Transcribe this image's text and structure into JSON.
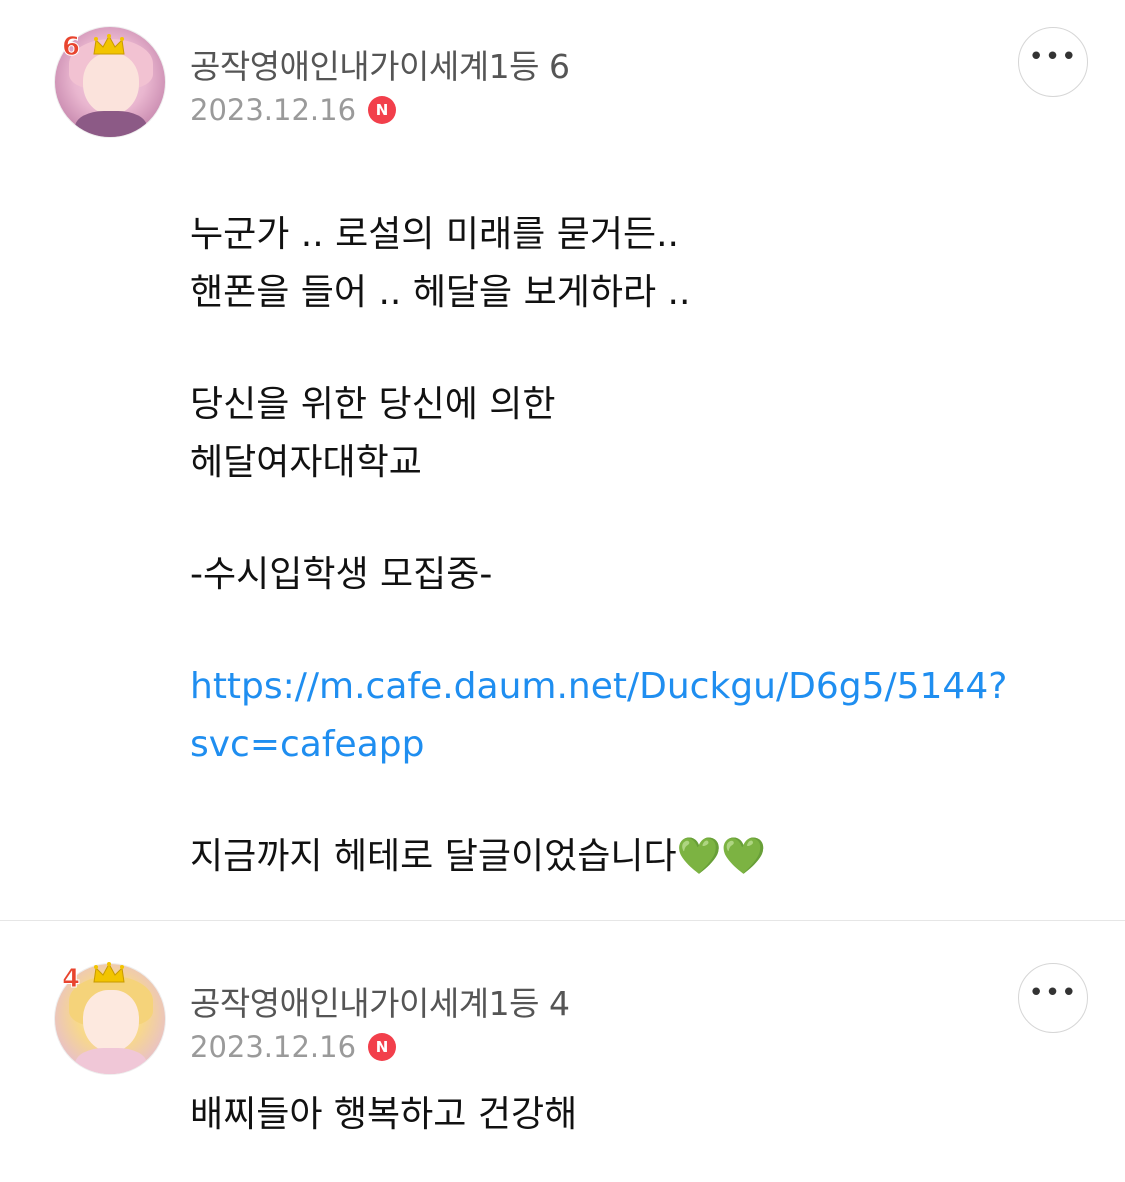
{
  "comments": [
    {
      "nickname": "공작영애인내가이세계1등 6",
      "rank_badge": "6",
      "date": "2023.12.16",
      "new_badge": "N",
      "more_icon": "•••",
      "body": {
        "line1": "누군가 .. 로설의 미래를 묻거든..",
        "line2": "핸폰을 들어 .. 헤달을 보게하라 ..",
        "line3": "당신을 위한 당신에 의한",
        "line4": "헤달여자대학교",
        "line5": "-수시입학생 모집중-",
        "link_line1": "https://m.cafe.daum.net/Duckgu/D6g5/5144?",
        "link_line2": "svc=cafeapp",
        "line6": "지금까지 헤테로 달글이었습니다",
        "hearts": "💚💚"
      }
    },
    {
      "nickname": "공작영애인내가이세계1등 4",
      "rank_badge": "4",
      "date": "2023.12.16",
      "new_badge": "N",
      "more_icon": "•••",
      "body": {
        "line1": "배찌들아 행복하고 건강해"
      }
    }
  ],
  "colors": {
    "link": "#1f8ef0",
    "new_badge": "#f23f4b",
    "date": "#9a9a9a",
    "nickname": "#555555",
    "rank": "#e8442e",
    "crown": "#f2c400"
  }
}
